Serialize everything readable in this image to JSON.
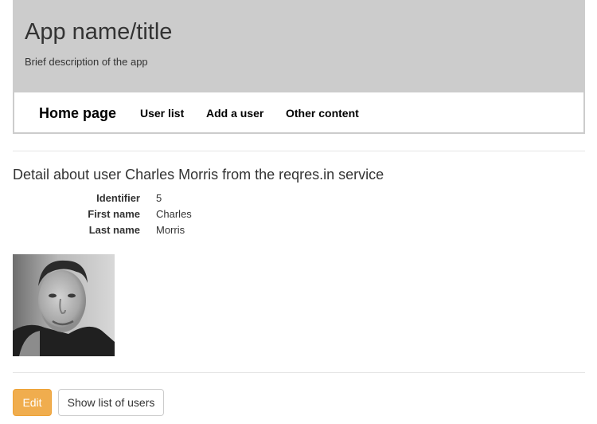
{
  "header": {
    "title": "App name/title",
    "description": "Brief description of the app"
  },
  "nav": {
    "brand": "Home page",
    "links": [
      {
        "label": "User list"
      },
      {
        "label": "Add a user"
      },
      {
        "label": "Other content"
      }
    ]
  },
  "detail": {
    "title": "Detail about user Charles Morris from the reqres.in service",
    "fields": [
      {
        "term": "Identifier",
        "value": "5"
      },
      {
        "term": "First name",
        "value": "Charles"
      },
      {
        "term": "Last name",
        "value": "Morris"
      }
    ]
  },
  "actions": {
    "edit_label": "Edit",
    "list_label": "Show list of users"
  }
}
